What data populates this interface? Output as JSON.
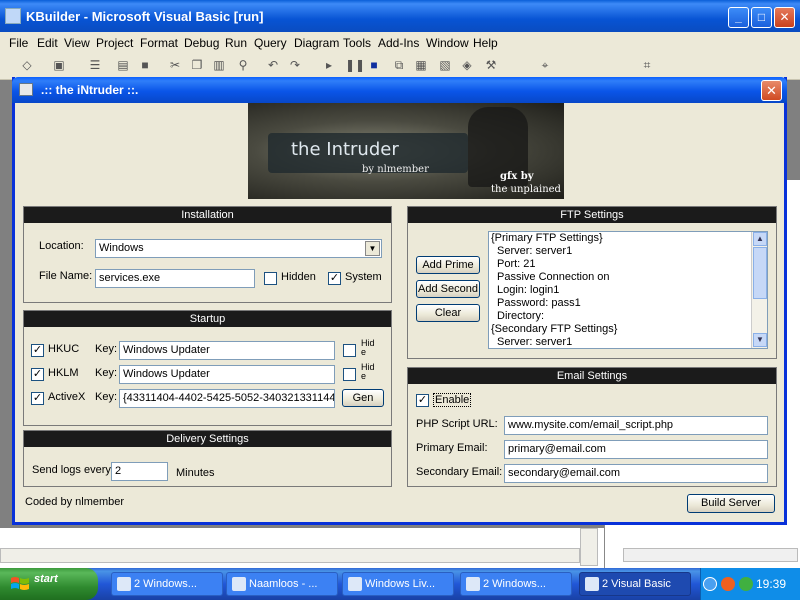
{
  "ide": {
    "title": "KBuilder - Microsoft Visual Basic [run]",
    "menu": [
      "File",
      "Edit",
      "View",
      "Project",
      "Format",
      "Debug",
      "Run",
      "Query",
      "Diagram",
      "Tools",
      "Add-Ins",
      "Window",
      "Help"
    ],
    "caption_buttons": [
      "minimize-icon",
      "maximize-icon",
      "close-icon"
    ]
  },
  "dialog": {
    "title": ".:: the iNtruder ::.",
    "banner": {
      "title": "the Intruder",
      "byline": "by nlmember",
      "gfx_line1": "gfx by",
      "gfx_line2": "the unplained"
    },
    "installation": {
      "header": "Installation",
      "location_label": "Location:",
      "location_value": "Windows",
      "filename_label": "File Name:",
      "filename_value": "services.exe",
      "hidden_label": "Hidden",
      "hidden_checked": false,
      "system_label": "System",
      "system_checked": true
    },
    "startup": {
      "header": "Startup",
      "key_label": "Key:",
      "rows": [
        {
          "name": "HKUC",
          "checked": true,
          "key": "Windows Updater",
          "hide_label": "Hid e"
        },
        {
          "name": "HKLM",
          "checked": true,
          "key": "Windows Updater",
          "hide_label": "Hid e"
        },
        {
          "name": "ActiveX",
          "checked": true,
          "key": "{43311404-4402-5425-5052-340321331144",
          "button": "Gen"
        }
      ]
    },
    "delivery": {
      "header": "Delivery Settings",
      "send_label": "Send logs every",
      "send_value": "2",
      "unit_label": "Minutes"
    },
    "ftp": {
      "header": "FTP Settings",
      "buttons": [
        "Add Prime",
        "Add Second",
        "Clear"
      ],
      "lines": [
        "{Primary FTP Settings}",
        "  Server: server1",
        "  Port: 21",
        "  Passive Connection on",
        "  Login: login1",
        "  Password: pass1",
        "  Directory:",
        "{Secondary FTP Settings}",
        "  Server: server1"
      ]
    },
    "email": {
      "header": "Email Settings",
      "enable_label": "Enable",
      "enable_checked": true,
      "php_label": "PHP Script URL:",
      "php_value": "www.mysite.com/email_script.php",
      "primary_label": "Primary Email:",
      "primary_value": "primary@email.com",
      "secondary_label": "Secondary Email:",
      "secondary_value": "secondary@email.com"
    },
    "footer": {
      "credit": "Coded by nlmember",
      "build_button": "Build Server"
    }
  },
  "taskbar": {
    "start_label": "start",
    "tasks": [
      "2 Windows...",
      "Naamloos - ...",
      "Windows Liv...",
      "2 Windows...",
      "2 Visual Basic"
    ],
    "active_task": 4,
    "clock": "19:39"
  },
  "colors": {
    "xp_blue": "#0a55e8",
    "panel_header": "#1b1b1b",
    "start_green": "#3c9a3c"
  }
}
